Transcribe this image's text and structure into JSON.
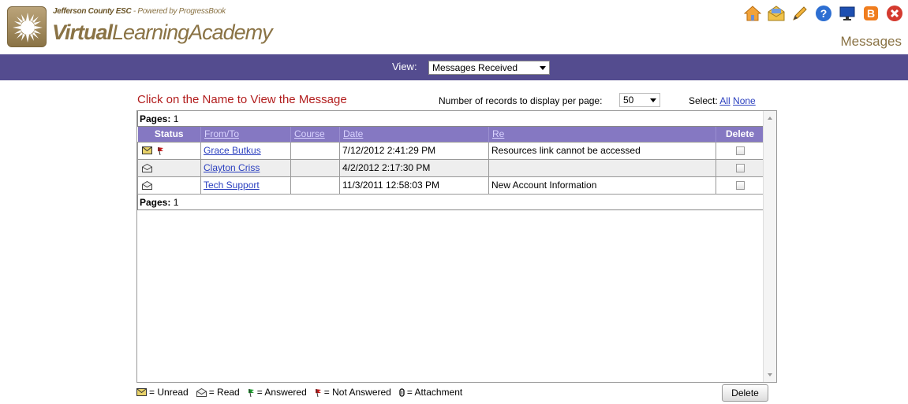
{
  "header": {
    "org": "Jefferson County ESC",
    "powered_by": " - Powered by ProgressBook",
    "brand_strong": "Virtual",
    "brand_rest": "LearningAcademy",
    "page_label": "Messages",
    "toolbar_icons": [
      "home-icon",
      "mail-icon",
      "pencil-icon",
      "help-icon",
      "monitor-icon",
      "blogger-icon",
      "close-icon"
    ]
  },
  "viewbar": {
    "label": "View:",
    "selected": "Messages Received"
  },
  "controls": {
    "instruction": "Click on the Name to View the Message",
    "records_label": "Number of records to display per page:",
    "records_value": "50",
    "select_label": "Select:",
    "select_all": "All",
    "select_none": "None"
  },
  "grid": {
    "pages_label": "Pages:",
    "pages_value": "1",
    "columns": [
      "Status",
      "From/To",
      "Course",
      "Date",
      "Re",
      "Delete"
    ],
    "rows": [
      {
        "status": [
          "unread-icon",
          "not-answered-flag-icon"
        ],
        "from": "Grace Butkus",
        "course": "",
        "date": "7/12/2012 2:41:29 PM",
        "re": "Resources link cannot be accessed"
      },
      {
        "status": [
          "read-icon"
        ],
        "from": "Clayton Criss",
        "course": "",
        "date": "4/2/2012 2:17:30 PM",
        "re": ""
      },
      {
        "status": [
          "read-icon"
        ],
        "from": "Tech Support",
        "course": "",
        "date": "11/3/2011 12:58:03 PM",
        "re": "New Account Information"
      }
    ]
  },
  "legend": {
    "unread": "= Unread",
    "read": "= Read",
    "answered": "= Answered",
    "not_answered": "= Not Answered",
    "attachment": "= Attachment"
  },
  "actions": {
    "delete": "Delete"
  },
  "colors": {
    "viewbar": "#544c8f",
    "header_brand": "#8a7345",
    "table_header": "#8578c2",
    "instruction": "#b21d1d",
    "link": "#2a3fbf"
  }
}
